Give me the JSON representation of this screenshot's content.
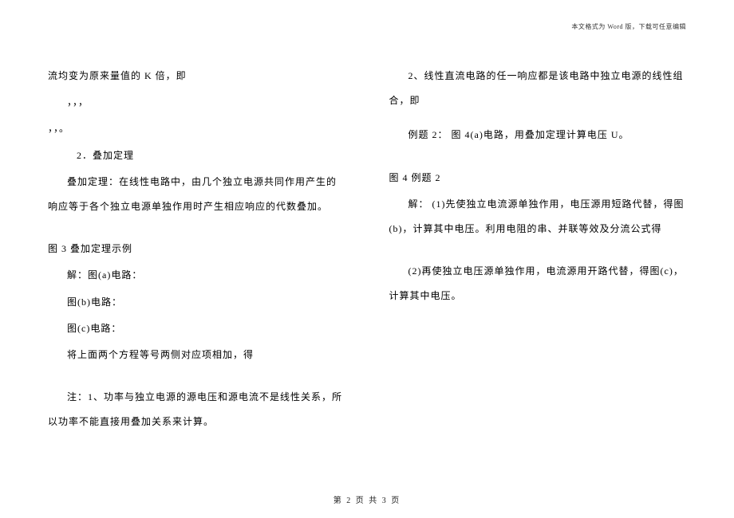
{
  "header": {
    "format_note": "本文格式为 Word 版，下载可任意编辑"
  },
  "content": {
    "line1": "流均变为原来量值的 K 倍，即",
    "line2": "，，，",
    "line3": "，，。",
    "heading_superposition": "2．叠加定理",
    "superposition_def": "叠加定理：在线性电路中，由几个独立电源共同作用产生的响应等于各个独立电源单独作用时产生相应响应的代数叠加。",
    "fig3_caption": "图 3  叠加定理示例",
    "solve_a": "解：图(a)电路：",
    "solve_b": "图(b)电路：",
    "solve_c": "图(c)电路：",
    "combine": "将上面两个方程等号两侧对应项相加，得",
    "note1": "注：1、功率与独立电源的源电压和源电流不是线性关系，所以功率不能直接用叠加关系来计算。",
    "note2": "2、线性直流电路的任一响应都是该电路中独立电源的线性组合，即",
    "example2_intro": "例题 2：  图 4(a)电路，用叠加定理计算电压 U。",
    "fig4_caption": "图 4    例题 2",
    "step1": "解：  (1)先使独立电流源单独作用，电压源用短路代替，得图(b)，计算其中电压。利用电阻的串、并联等效及分流公式得",
    "step2": "(2)再使独立电压源单独作用，电流源用开路代替，得图(c)，计算其中电压。"
  },
  "footer": {
    "page_label": "第 2 页 共 3 页"
  }
}
